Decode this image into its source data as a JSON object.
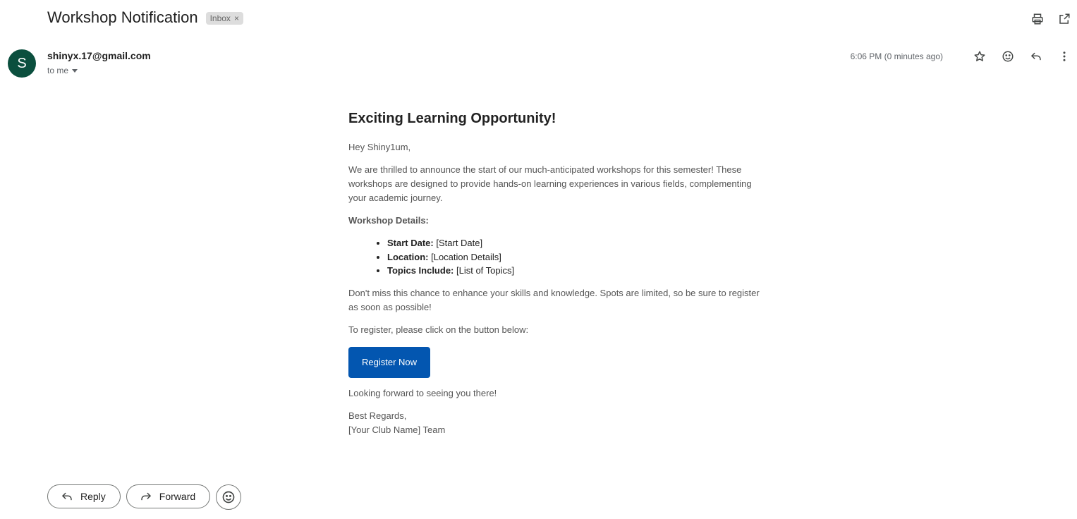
{
  "header": {
    "subject": "Workshop Notification",
    "label": "Inbox",
    "label_remove": "×"
  },
  "sender": {
    "avatar_letter": "S",
    "avatar_color": "#0b4f3e",
    "email": "shinyx.17@gmail.com",
    "recipient": "to me",
    "timestamp": "6:06 PM (0 minutes ago)"
  },
  "icons": {
    "top": [
      "print-icon",
      "open-in-new-window-icon"
    ],
    "meta": [
      "star-icon",
      "emoji-reaction-icon",
      "reply-icon",
      "more-options-icon"
    ]
  },
  "email_body": {
    "heading": "Exciting Learning Opportunity!",
    "greeting": "Hey Shiny1um,",
    "intro": "We are thrilled to announce the start of our much-anticipated workshops for this semester! These workshops are designed to provide hands-on learning experiences in various fields, complementing your academic journey.",
    "details_title": "Workshop Details:",
    "details": [
      {
        "label": "Start Date:",
        "value": " [Start Date]"
      },
      {
        "label": "Location:",
        "value": " [Location Details]"
      },
      {
        "label": "Topics Include:",
        "value": " [List of Topics]"
      }
    ],
    "cta_text": "Don't miss this chance to enhance your skills and knowledge. Spots are limited, so be sure to register as soon as possible!",
    "register_prompt": "To register, please click on the button below:",
    "register_button": "Register Now",
    "register_button_color": "#0356b0",
    "closing": "Looking forward to seeing you there!",
    "regards": "Best Regards,",
    "team": "[Your Club Name] Team"
  },
  "footer": {
    "reply_label": "Reply",
    "forward_label": "Forward"
  }
}
